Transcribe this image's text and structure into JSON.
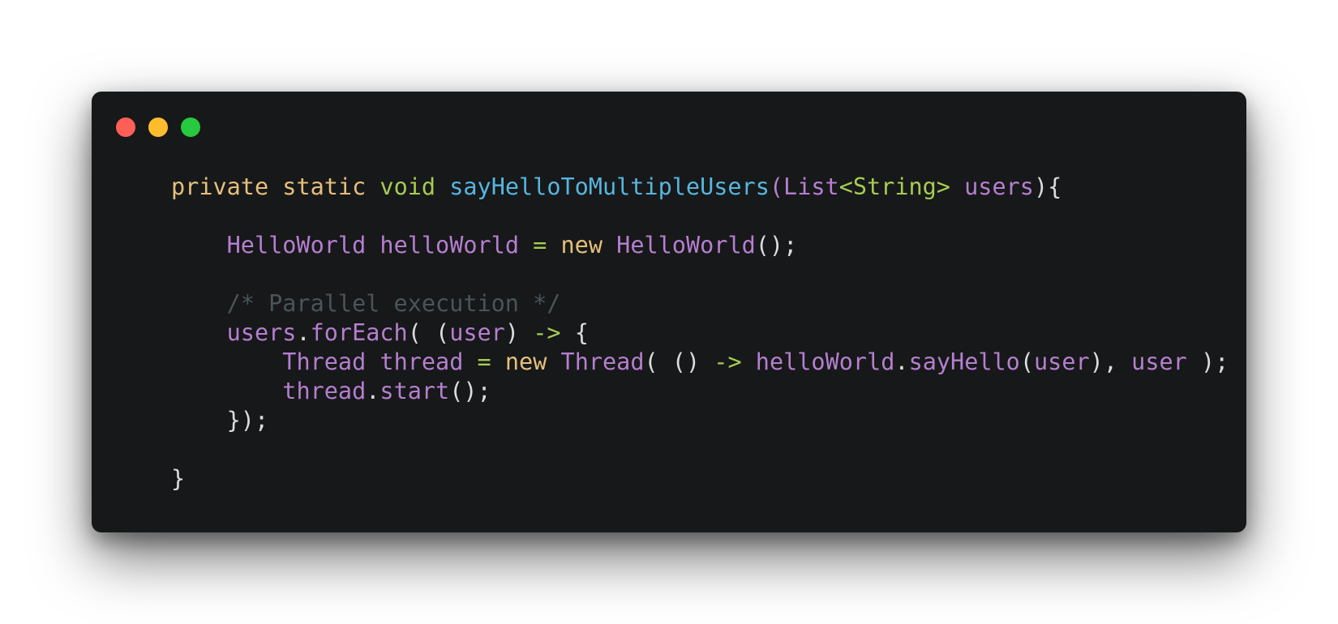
{
  "window": {
    "controls": [
      "close",
      "minimize",
      "maximize"
    ],
    "colors": {
      "background": "#171819",
      "close": "#ff5f56",
      "minimize": "#ffbd2e",
      "maximize": "#27c93f"
    }
  },
  "code": {
    "line1": {
      "kw_private": "private",
      "kw_static": "static",
      "type_void": "void",
      "method_name": "sayHelloToMultipleUsers",
      "paren_open": "(",
      "type_list": "List",
      "generic": "<String>",
      "param_users": "users",
      "close": "){"
    },
    "line3": {
      "type": "HelloWorld",
      "var": "helloWorld",
      "assign": "=",
      "kw_new": "new",
      "ctor": "HelloWorld",
      "end": "();"
    },
    "line5": {
      "comment": "/* Parallel execution */"
    },
    "line6": {
      "obj": "users",
      "dot": ".",
      "method": "forEach",
      "open": "( (",
      "param": "user",
      "close": ")",
      "arrow": "->",
      "brace": "{"
    },
    "line7": {
      "type": "Thread",
      "var": "thread",
      "assign": "=",
      "kw_new": "new",
      "ctor": "Thread",
      "open": "( ()",
      "arrow": "->",
      "obj": "helloWorld",
      "dot": ".",
      "method": "sayHello",
      "p_open": "(",
      "arg": "user",
      "p_close": "),",
      "arg2": "user",
      "end": ");"
    },
    "line8": {
      "obj": "thread",
      "dot": ".",
      "method": "start",
      "end": "();"
    },
    "line9": {
      "end": "});"
    },
    "line11": {
      "end": "}"
    }
  },
  "syntax_colors": {
    "keyword": "#e5c07b",
    "type": "#a6cc53",
    "function": "#56b6e0",
    "identifier": "#b57fd0",
    "punctuation": "#dcdcdc",
    "comment": "#4a5459"
  }
}
